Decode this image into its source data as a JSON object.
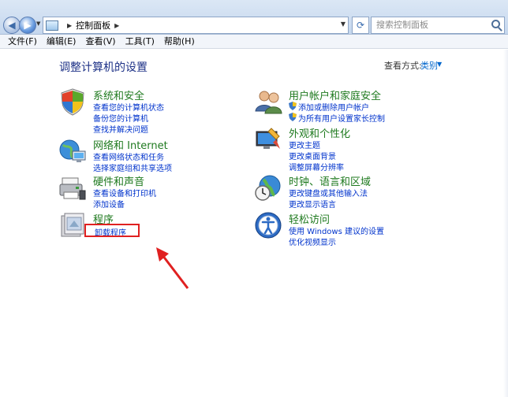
{
  "address_bar": {
    "breadcrumb": "控制面板",
    "search_placeholder": "搜索控制面板"
  },
  "menu": [
    "文件(F)",
    "编辑(E)",
    "查看(V)",
    "工具(T)",
    "帮助(H)"
  ],
  "page": {
    "title": "调整计算机的设置",
    "view_by_label": "查看方式:",
    "view_by_value": "类别"
  },
  "categories_left": [
    {
      "title": "系统和安全",
      "icon": "shield-icon",
      "links": [
        "查看您的计算机状态",
        "备份您的计算机",
        "查找并解决问题"
      ]
    },
    {
      "title": "网络和 Internet",
      "icon": "network-icon",
      "links": [
        "查看网络状态和任务",
        "选择家庭组和共享选项"
      ]
    },
    {
      "title": "硬件和声音",
      "icon": "printer-icon",
      "links": [
        "查看设备和打印机",
        "添加设备"
      ]
    },
    {
      "title": "程序",
      "icon": "programs-icon",
      "links": [
        "卸载程序"
      ]
    }
  ],
  "categories_right": [
    {
      "title": "用户帐户和家庭安全",
      "icon": "users-icon",
      "links": [
        "添加或删除用户帐户",
        "为所有用户设置家长控制"
      ]
    },
    {
      "title": "外观和个性化",
      "icon": "appearance-icon",
      "links": [
        "更改主题",
        "更改桌面背景",
        "调整屏幕分辨率"
      ]
    },
    {
      "title": "时钟、语言和区域",
      "icon": "clock-globe-icon",
      "links": [
        "更改键盘或其他输入法",
        "更改显示语言"
      ]
    },
    {
      "title": "轻松访问",
      "icon": "accessibility-icon",
      "links": [
        "使用 Windows 建议的设置",
        "优化视频显示"
      ]
    }
  ],
  "colors": {
    "category_title": "#1f7a1f",
    "link": "#0033cc",
    "page_title": "#1e3287",
    "annotation": "#e02020"
  }
}
